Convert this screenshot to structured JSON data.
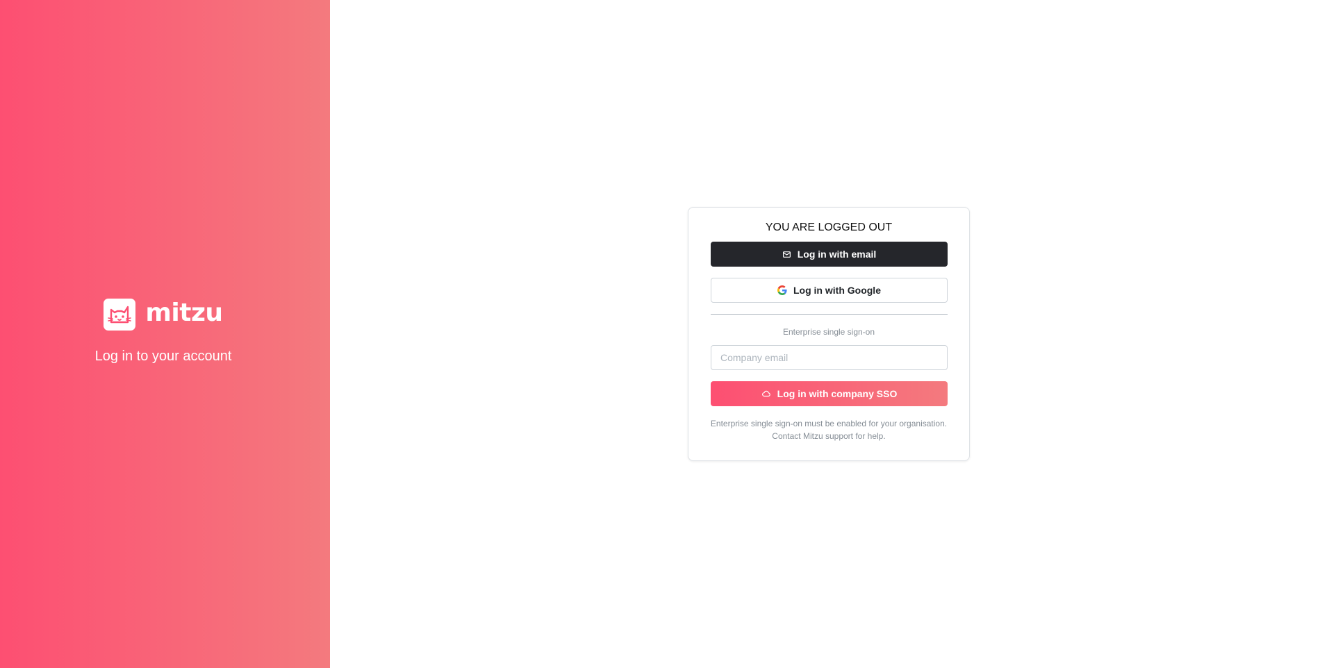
{
  "brand": {
    "name": "mitzu",
    "subtitle": "Log in to your account",
    "logo_icon": "cat-logo-icon",
    "gradient_start": "#fd4f72",
    "gradient_end": "#f47a7e"
  },
  "card": {
    "title": "YOU ARE LOGGED OUT",
    "email_button": {
      "label": "Log in with email",
      "icon": "mail-icon"
    },
    "google_button": {
      "label": "Log in with Google",
      "icon": "google-icon"
    },
    "sso_label": "Enterprise single sign-on",
    "company_email": {
      "placeholder": "Company email",
      "value": ""
    },
    "sso_button": {
      "label": "Log in with company SSO",
      "icon": "cloud-icon"
    },
    "help_line1": "Enterprise single sign-on must be enabled for your organisation.",
    "help_line2": "Contact Mitzu support for help."
  }
}
